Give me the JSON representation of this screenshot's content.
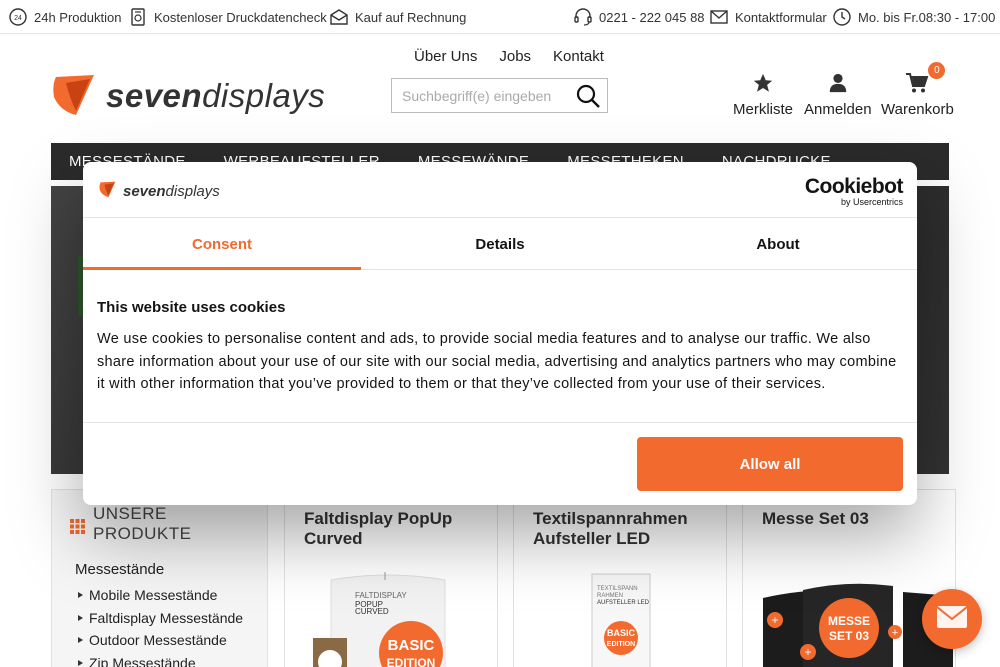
{
  "topbar": {
    "production": "24h Produktion",
    "check": "Kostenloser Druckdatencheck",
    "invoice": "Kauf auf Rechnung",
    "phone": "0221 - 222 045 88",
    "contact": "Kontaktformular",
    "hours": "Mo. bis Fr.08:30 - 17:00",
    "badge24": "24"
  },
  "header": {
    "logo_bold": "seven",
    "logo_light": "displays",
    "links": [
      "Über Uns",
      "Jobs",
      "Kontakt"
    ],
    "search_placeholder": "Suchbegriff(e) eingeben",
    "wishlist": "Merkliste",
    "login": "Anmelden",
    "cart": "Warenkorb",
    "cart_count": "0"
  },
  "nav": {
    "items": [
      "Messestände",
      "Werbeaufsteller",
      "Messewände",
      "Messetheken",
      "Nachdrucke"
    ]
  },
  "sidebar": {
    "heading_line1": "UNSERE",
    "heading_line2": "PRODUKTE",
    "category": "Messestände",
    "items": [
      "Mobile Messestände",
      "Faltdisplay Messestände",
      "Outdoor Messestände",
      "Zip Messestände"
    ]
  },
  "cards": [
    {
      "title": "Faltdisplay PopUp Curved",
      "img_label1": "FALTDISPLAY",
      "img_label2": "POPUP",
      "img_label3": "CURVED",
      "badge1": "BASIC",
      "badge2": "EDITION"
    },
    {
      "title": "Textilspannrahmen Aufsteller LED",
      "img_label1": "TEXTILSPANN",
      "img_label2": "RAHMEN",
      "img_label3": "AUFSTELLER LED",
      "badge1": "BASIC",
      "badge2": "EDITION"
    },
    {
      "title": "Messe Set 03",
      "badge1": "MESSE",
      "badge2": "SET 03"
    }
  ],
  "consent": {
    "logo_bold": "seven",
    "logo_light": "displays",
    "brand": "Cookiebot",
    "brand_sub": "by Usercentrics",
    "tabs": [
      "Consent",
      "Details",
      "About"
    ],
    "title": "This website uses cookies",
    "text": "We use cookies to personalise content and ads, to provide social media features and to analyse our traffic. We also share information about your use of our site with our social media, advertising and analytics partners who may combine it with other information that you’ve provided to them or that they’ve collected from your use of their services.",
    "allow_all": "Allow all"
  },
  "colors": {
    "accent": "#f26a2e",
    "nav_bg": "#2b2b2b"
  }
}
